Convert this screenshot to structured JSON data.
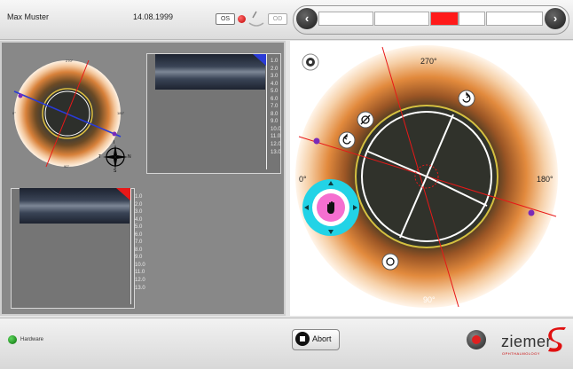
{
  "header": {
    "patient_name": "Max Muster",
    "patient_dob": "14.08.1999",
    "eye_left": "OS",
    "eye_right": "OD",
    "stepper": {
      "prev_icon": "chevron-left-icon",
      "next_icon": "chevron-right-icon",
      "step_count": 5,
      "active_step": 3
    }
  },
  "left_panel": {
    "overview_labels": {
      "top": "270°",
      "bottom": "90°",
      "left": "0°",
      "right": "180°"
    },
    "compass": {
      "n": "I",
      "s": "S",
      "e": "N",
      "w": "T"
    },
    "scan_top": {
      "scale": [
        "1.0",
        "2.0",
        "3.0",
        "4.0",
        "5.0",
        "6.0",
        "7.0",
        "8.0",
        "9.0",
        "10.0",
        "11.0",
        "12.0",
        "13.0"
      ]
    },
    "scan_bottom": {
      "scale": [
        "1.0",
        "2.0",
        "3.0",
        "4.0",
        "5.0",
        "6.0",
        "7.0",
        "8.0",
        "9.0",
        "10.0",
        "11.0",
        "12.0",
        "13.0"
      ]
    }
  },
  "right_panel": {
    "angle_labels": {
      "top": "270°",
      "bottom": "90°",
      "left": "0°",
      "right": "180°"
    }
  },
  "footer": {
    "hardware_label": "Hardware",
    "abort_label": "Abort",
    "logo": "ziemer",
    "logo_sub": "OPHTHALMOLOGY"
  },
  "colors": {
    "accent_red": "#ff1a1a",
    "joystick_cyan": "#22d3e6",
    "joystick_pink": "#f56fd0"
  }
}
